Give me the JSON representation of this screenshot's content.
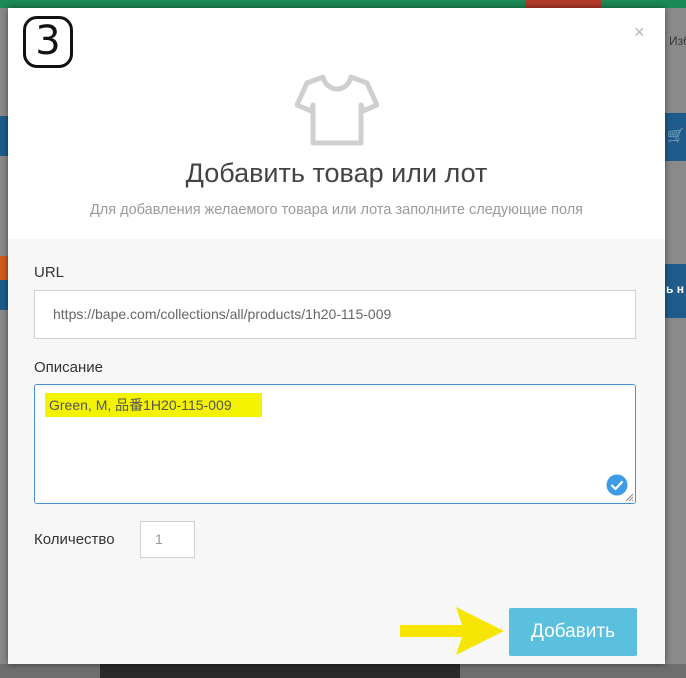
{
  "modal": {
    "step_number": "3",
    "close_label": "×",
    "title": "Добавить товар или лот",
    "subtitle": "Для добавления желаемого товара или лота заполните следующие поля"
  },
  "form": {
    "url_label": "URL",
    "url_value": "https://bape.com/collections/all/products/1h20-115-009",
    "description_label": "Описание",
    "description_value": "Green, M, 品番1H20-115-009",
    "quantity_label": "Количество",
    "quantity_value": "1",
    "submit_label": "Добавить"
  },
  "background": {
    "favorites_fragment": "Изб",
    "button_fragment": "ь н"
  },
  "colors": {
    "submit_button": "#5bc0de",
    "highlight": "#f3f300",
    "annotation_arrow": "#f5e500"
  }
}
